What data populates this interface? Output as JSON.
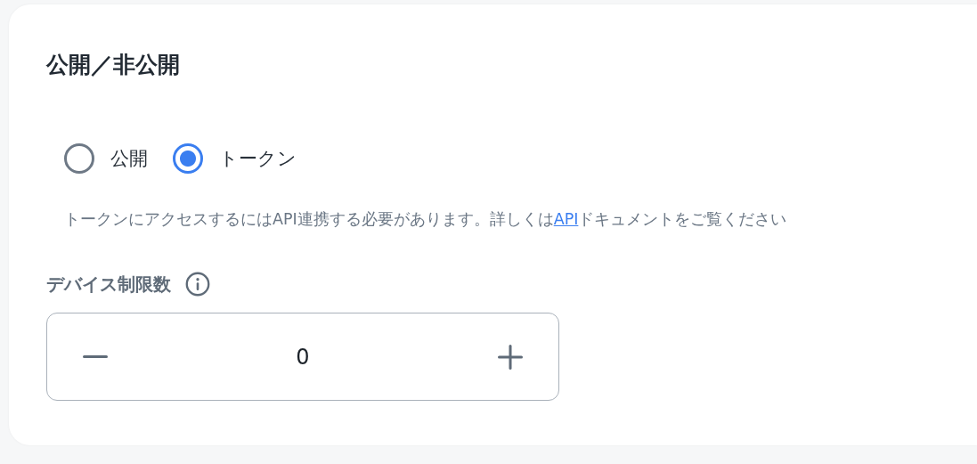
{
  "section": {
    "title": "公開／非公開"
  },
  "visibility_options": [
    {
      "label": "公開",
      "selected": false
    },
    {
      "label": "トークン",
      "selected": true
    }
  ],
  "help_text": {
    "before": "トークンにアクセスするにはAPI連携する必要があります。詳しくは",
    "link": "API",
    "after": "ドキュメントをご覧ください"
  },
  "device_limit": {
    "label": "デバイス制限数",
    "value": "0"
  }
}
